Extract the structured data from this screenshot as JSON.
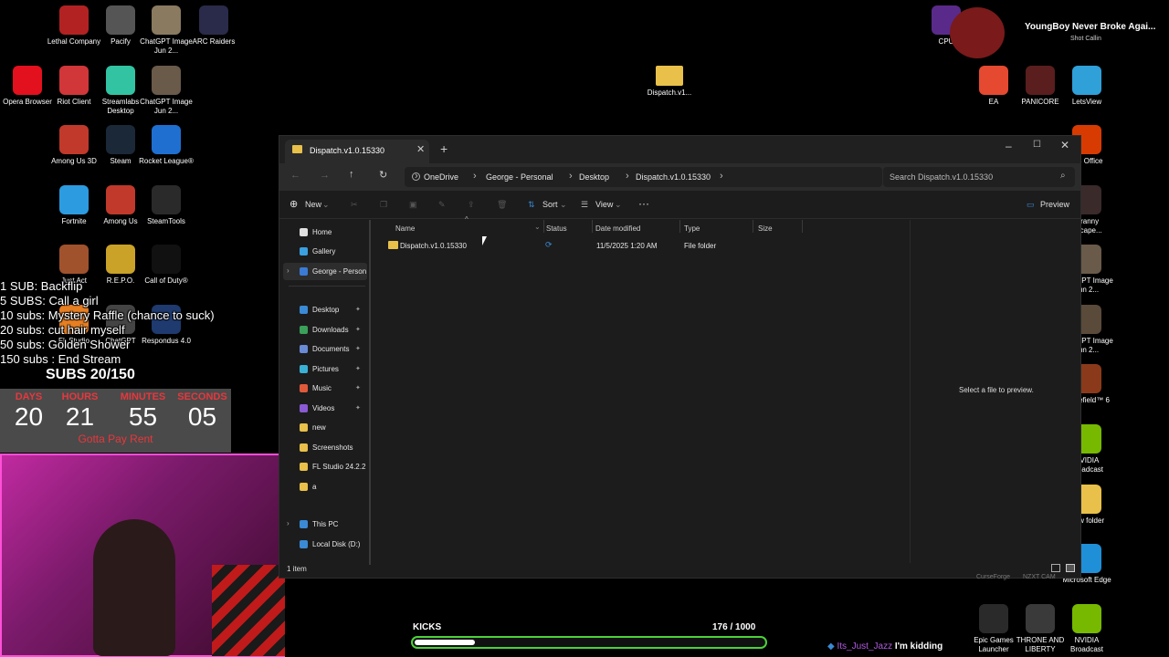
{
  "desktop": {
    "left_icons": [
      {
        "label": "Lethal Company",
        "color": "#b22222"
      },
      {
        "label": "Pacify",
        "color": "#555555"
      },
      {
        "label": "ChatGPT Image Jun 2...",
        "color": "#8a7a60"
      },
      {
        "label": "ARC Raiders",
        "color": "#2a2a4a"
      },
      {
        "label": "Opera Browser",
        "color": "#e3101e"
      },
      {
        "label": "Riot Client",
        "color": "#d13639"
      },
      {
        "label": "Streamlabs Desktop",
        "color": "#31c3a2"
      },
      {
        "label": "ChatGPT Image Jun 2...",
        "color": "#6a5a4a"
      },
      {
        "label": "Among Us 3D",
        "color": "#c0392b"
      },
      {
        "label": "Steam",
        "color": "#1b2838"
      },
      {
        "label": "Rocket League®",
        "color": "#1f6fd1"
      },
      {
        "label": "Fortnite",
        "color": "#2c9be0"
      },
      {
        "label": "Among Us",
        "color": "#c0392b"
      },
      {
        "label": "SteamTools",
        "color": "#2a2a2a"
      },
      {
        "label": "Just Act",
        "color": "#a0522d"
      },
      {
        "label": "R.E.P.O.",
        "color": "#c9a227"
      },
      {
        "label": "Call of Duty®",
        "color": "#111111"
      },
      {
        "label": "FL Studio",
        "color": "#e67e22"
      },
      {
        "label": "ChatGPT",
        "color": "#444444"
      },
      {
        "label": "Respondus 4.0",
        "color": "#1e3a6e"
      }
    ],
    "folder_icon_label": "Dispatch.v1...",
    "right_icons": [
      {
        "label": "CPU",
        "color": "#5a2a8a"
      },
      {
        "label": "EA",
        "color": "#e5492f"
      },
      {
        "label": "PANICORE",
        "color": "#5a1e1e"
      },
      {
        "label": "LetsView",
        "color": "#2fa0d8"
      },
      {
        "label": "MS Office",
        "color": "#d83b01"
      },
      {
        "label": "Granny Escape...",
        "color": "#3a2a2a"
      },
      {
        "label": "ChatGPT Image Jun 2...",
        "color": "#6a5a4a"
      },
      {
        "label": "ChatGPT Image Jun 2...",
        "color": "#5a4a3a"
      },
      {
        "label": "Battlefield™ 6",
        "color": "#8a3a1a"
      },
      {
        "label": "NVIDIA Broadcast",
        "color": "#76b900"
      },
      {
        "label": "New folder",
        "color": "#e8c04a"
      },
      {
        "label": "Microsoft Edge",
        "color": "#1f8fd8"
      },
      {
        "label": "Epic Games Launcher",
        "color": "#2a2a2a"
      },
      {
        "label": "THRONE AND LIBERTY",
        "color": "#3a3a3a"
      },
      {
        "label": "NVIDIA Broadcast",
        "color": "#76b900"
      }
    ],
    "bottom_labels": [
      "CurseForge",
      "NZXT CAM"
    ]
  },
  "stream": {
    "goals": [
      "1 SUB: Backflip",
      "5 SUBS: Call a girl",
      "10 subs: Mystery Raffle (chance to suck)",
      "20 subs: cut hair myself",
      "50 subs: Golden Shower",
      "150 subs : End Stream"
    ],
    "subs_counter": "SUBS 20/150",
    "timer": {
      "labels": [
        "DAYS",
        "HOURS",
        "MINUTES",
        "SECONDS"
      ],
      "values": [
        "20",
        "21",
        "55",
        "05"
      ],
      "caption": "Gotta Pay Rent"
    },
    "now_playing": {
      "title": "YoungBoy Never Broke Agai...",
      "subtitle": "Shot Callin"
    },
    "kicks": {
      "label": "KICKS",
      "current": "176",
      "separator": "/",
      "goal": "1000",
      "fraction": 0.176
    },
    "chat": {
      "user": "Its_Just_Jazz",
      "message": "I'm kidding"
    }
  },
  "explorer": {
    "tab_title": "Dispatch.v1.0.15330",
    "breadcrumb": [
      "OneDrive",
      "George - Personal",
      "Desktop",
      "Dispatch.v1.0.15330"
    ],
    "search_placeholder": "Search Dispatch.v1.0.15330",
    "commands": {
      "new": "New",
      "sort": "Sort",
      "view": "View",
      "more": "···",
      "preview": "Preview"
    },
    "nav": {
      "top": [
        {
          "label": "Home",
          "color": "#e0e0e0"
        },
        {
          "label": "Gallery",
          "color": "#3aa0e0"
        },
        {
          "label": "George - Person",
          "color": "#3a7bd5"
        }
      ],
      "pinned": [
        {
          "label": "Desktop",
          "color": "#3a8ad5"
        },
        {
          "label": "Downloads",
          "color": "#3aa05a"
        },
        {
          "label": "Documents",
          "color": "#6a8ad5"
        },
        {
          "label": "Pictures",
          "color": "#3ab0d5"
        },
        {
          "label": "Music",
          "color": "#e05a3a"
        },
        {
          "label": "Videos",
          "color": "#8a5ad5"
        }
      ],
      "folders": [
        {
          "label": "new"
        },
        {
          "label": "Screenshots"
        },
        {
          "label": "FL Studio 24.2.2"
        },
        {
          "label": "a"
        }
      ],
      "bottom": [
        {
          "label": "This PC"
        },
        {
          "label": "Local Disk (D:)"
        }
      ]
    },
    "columns": [
      "Name",
      "Status",
      "Date modified",
      "Type",
      "Size"
    ],
    "rows": [
      {
        "name": "Dispatch.v1.0.15330",
        "status": "sync",
        "date": "11/5/2025 1:20 AM",
        "type": "File folder",
        "size": ""
      }
    ],
    "preview_text": "Select a file to preview.",
    "status_text": "1 item"
  }
}
